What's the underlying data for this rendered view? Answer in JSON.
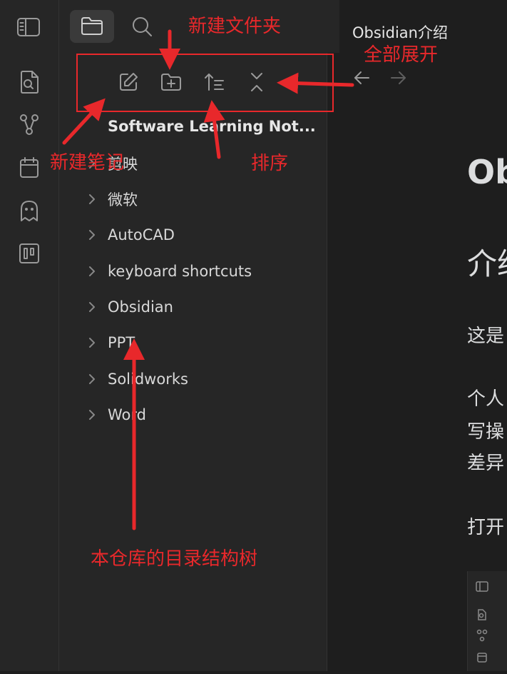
{
  "ribbon": {
    "icons": [
      "search-file-icon",
      "graph-icon",
      "calendar-icon",
      "ghost-icon",
      "kanban-icon"
    ]
  },
  "topbar": {
    "sidebar_toggle_icon": "sidebar-toggle-icon",
    "files_tab_icon": "folder-icon",
    "search_tab_icon": "search-icon"
  },
  "document_tab": {
    "title": "Obsidian介绍"
  },
  "file_explorer": {
    "toolbar": [
      "new-note-icon",
      "new-folder-icon",
      "sort-icon",
      "expand-all-icon"
    ],
    "vault_name": "Software Learning Not...",
    "items": [
      {
        "label": "剪映"
      },
      {
        "label": "微软"
      },
      {
        "label": "AutoCAD"
      },
      {
        "label": "keyboard shortcuts"
      },
      {
        "label": "Obsidian"
      },
      {
        "label": "PPT"
      },
      {
        "label": "Solidworks"
      },
      {
        "label": "Word"
      }
    ]
  },
  "navigation": {
    "back_icon": "arrow-left-icon",
    "forward_icon": "arrow-right-icon"
  },
  "editor": {
    "heading1": "Ob",
    "heading2": "介绍",
    "lines": [
      "这是",
      "个人",
      "写操",
      "差异",
      "打开"
    ]
  },
  "annotations": {
    "new_folder": "新建文件夹",
    "expand_all": "全部展开",
    "new_note": "新建笔记",
    "sort": "排序",
    "tree": "本仓库的目录结构树"
  },
  "colors": {
    "annotation": "#e8282b",
    "background": "#1e1e1e",
    "panel": "#262626"
  }
}
